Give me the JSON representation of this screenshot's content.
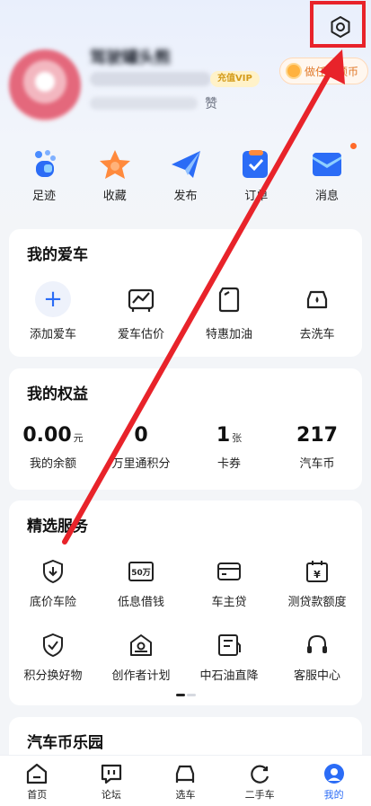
{
  "header": {
    "username": "驾驶罐头熊",
    "vip_badge": "充值VIP",
    "likes_label": "赞",
    "task_button": "做任务领币"
  },
  "quick_actions": [
    {
      "label": "足迹",
      "icon": "footprint-icon"
    },
    {
      "label": "收藏",
      "icon": "star-icon"
    },
    {
      "label": "发布",
      "icon": "send-icon"
    },
    {
      "label": "订单",
      "icon": "order-icon"
    },
    {
      "label": "消息",
      "icon": "message-icon"
    }
  ],
  "my_car": {
    "title": "我的爱车",
    "items": [
      {
        "label": "添加爱车",
        "icon": "plus-icon"
      },
      {
        "label": "爱车估价",
        "icon": "car-value-icon"
      },
      {
        "label": "特惠加油",
        "icon": "fuel-icon"
      },
      {
        "label": "去洗车",
        "icon": "car-wash-icon"
      }
    ]
  },
  "benefits": {
    "title": "我的权益",
    "items": [
      {
        "value": "0.00",
        "unit": "元",
        "label": "我的余额"
      },
      {
        "value": "0",
        "unit": "",
        "label": "万里通积分"
      },
      {
        "value": "1",
        "unit": "张",
        "label": "卡券"
      },
      {
        "value": "217",
        "unit": "",
        "label": "汽车币"
      }
    ]
  },
  "services": {
    "title": "精选服务",
    "row1": [
      {
        "label": "底价车险",
        "icon": "shield-download-icon"
      },
      {
        "label": "低息借钱",
        "icon": "loan-50w-icon",
        "badge": "50万"
      },
      {
        "label": "车主贷",
        "icon": "card-icon"
      },
      {
        "label": "测贷款额度",
        "icon": "calendar-yen-icon",
        "badge": "¥"
      }
    ],
    "row2": [
      {
        "label": "积分换好物",
        "icon": "shield-check-icon"
      },
      {
        "label": "创作者计划",
        "icon": "creator-icon"
      },
      {
        "label": "中石油直降",
        "icon": "fuel-card-icon"
      },
      {
        "label": "客服中心",
        "icon": "headset-icon"
      }
    ]
  },
  "coin_park": {
    "title": "汽车币乐园"
  },
  "bottom_nav": [
    {
      "label": "首页",
      "icon": "home-icon"
    },
    {
      "label": "论坛",
      "icon": "forum-icon"
    },
    {
      "label": "选车",
      "icon": "car-select-icon"
    },
    {
      "label": "二手车",
      "icon": "used-car-icon"
    },
    {
      "label": "我的",
      "icon": "profile-icon",
      "active": true
    }
  ],
  "colors": {
    "accent": "#2b6cf6",
    "annotation_red": "#e8232a"
  }
}
